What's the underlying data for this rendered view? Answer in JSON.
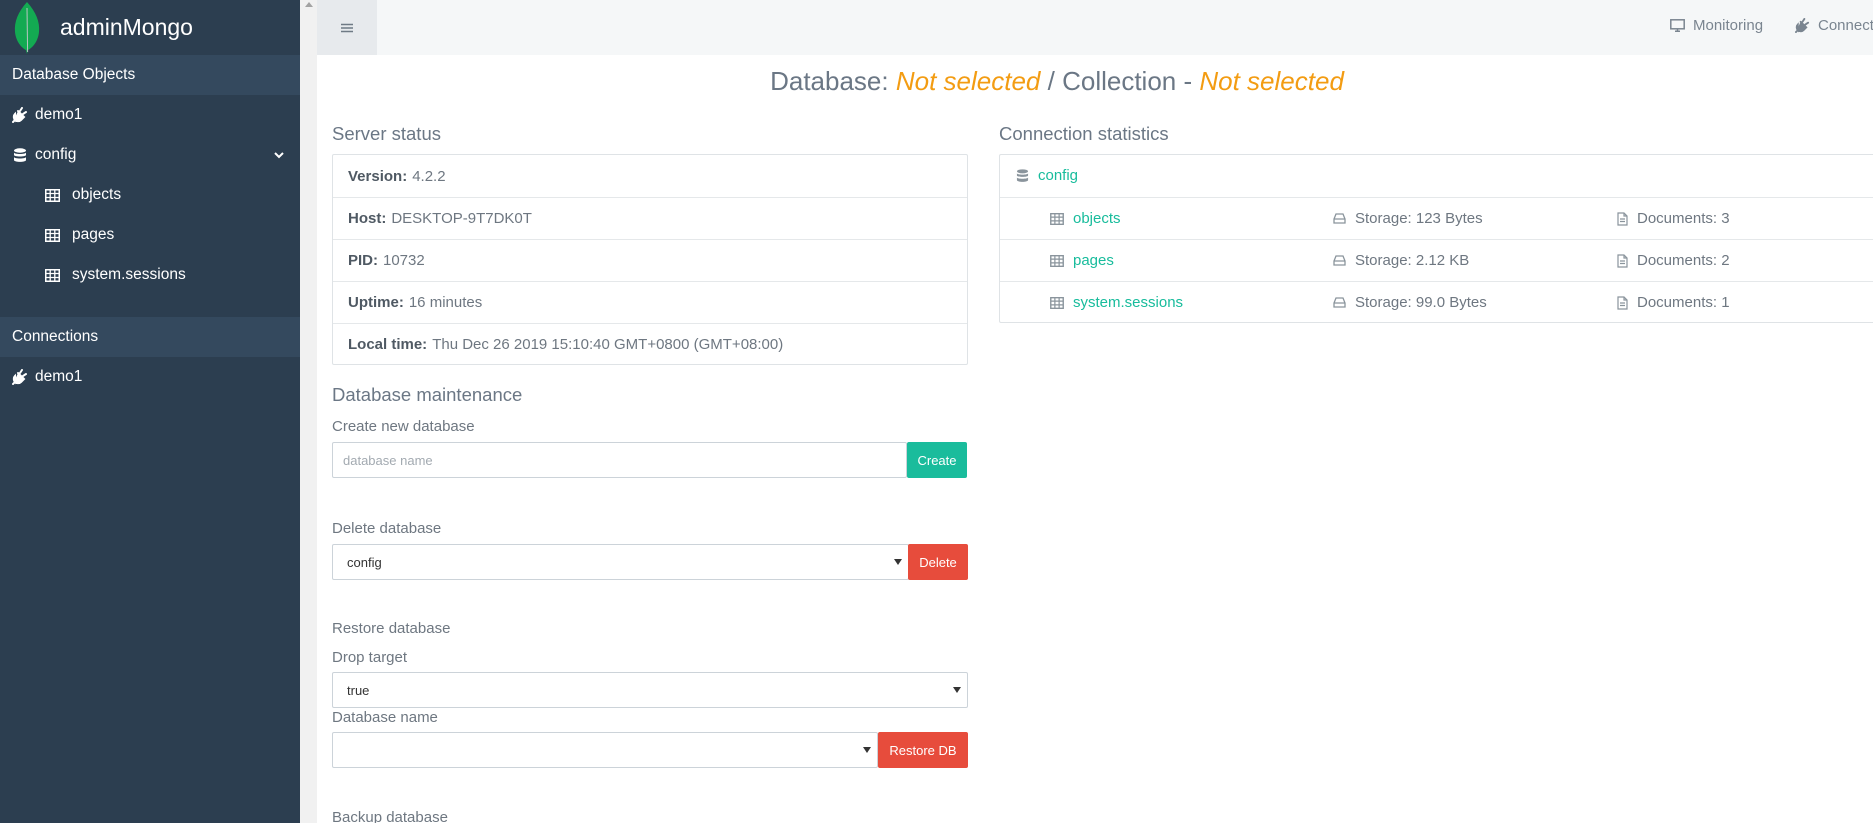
{
  "sidebar": {
    "brand": "adminMongo",
    "objects_header": "Database Objects",
    "db_items": [
      {
        "label": "demo1",
        "icon": "plug-icon"
      },
      {
        "label": "config",
        "icon": "database-icon"
      }
    ],
    "collections": [
      "objects",
      "pages",
      "system.sessions"
    ],
    "connections_header": "Connections",
    "connections": [
      "demo1"
    ]
  },
  "topbar": {
    "monitoring": "Monitoring",
    "connections": "Connections"
  },
  "heading": {
    "db_label": "Database:",
    "db_value": "Not selected",
    "sep": "/",
    "coll_label": "Collection -",
    "coll_value": "Not selected"
  },
  "server_status": {
    "title": "Server status",
    "rows": [
      {
        "key": "Version:",
        "value": "4.2.2"
      },
      {
        "key": "Host:",
        "value": "DESKTOP-9T7DK0T"
      },
      {
        "key": "PID:",
        "value": "10732"
      },
      {
        "key": "Uptime:",
        "value": "16 minutes"
      },
      {
        "key": "Local time:",
        "value": "Thu Dec 26 2019 15:10:40 GMT+0800 (GMT+08:00)"
      }
    ]
  },
  "maintenance": {
    "title": "Database maintenance",
    "create_label": "Create new database",
    "create_placeholder": "database name",
    "create_button": "Create",
    "delete_label": "Delete database",
    "delete_selected": "config",
    "delete_button": "Delete",
    "restore_label": "Restore database",
    "drop_target_label": "Drop target",
    "drop_target_value": "true",
    "db_name_label": "Database name",
    "db_name_value": "",
    "restore_button": "Restore DB",
    "backup_label": "Backup database"
  },
  "connection_stats": {
    "title": "Connection statistics",
    "database": "config",
    "collections": [
      {
        "name": "objects",
        "storage": "Storage: 123 Bytes",
        "documents": "Documents: 3"
      },
      {
        "name": "pages",
        "storage": "Storage: 2.12 KB",
        "documents": "Documents: 2"
      },
      {
        "name": "system.sessions",
        "storage": "Storage: 99.0 Bytes",
        "documents": "Documents: 1"
      }
    ]
  },
  "colors": {
    "sidebar_bg": "#2c3e50",
    "accent_green": "#18bc9c",
    "accent_orange": "#f39c12",
    "danger_red": "#e74c3c"
  }
}
